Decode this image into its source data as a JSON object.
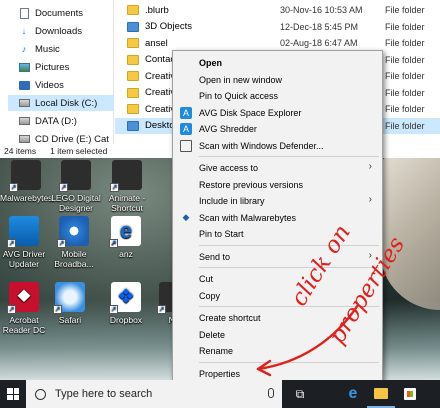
{
  "explorer": {
    "nav": [
      {
        "label": "Documents",
        "icon": "document-icon"
      },
      {
        "label": "Downloads",
        "icon": "download-icon"
      },
      {
        "label": "Music",
        "icon": "music-icon"
      },
      {
        "label": "Pictures",
        "icon": "pictures-icon"
      },
      {
        "label": "Videos",
        "icon": "videos-icon"
      },
      {
        "label": "Local Disk (C:)",
        "icon": "disk-icon",
        "selected": true
      },
      {
        "label": "DATA (D:)",
        "icon": "disk-icon"
      },
      {
        "label": "CD Drive (E:) Cat",
        "icon": "cd-drive-icon"
      }
    ],
    "files": [
      {
        "name": ".blurb",
        "date": "30-Nov-16 10:53 AM",
        "type": "File folder"
      },
      {
        "name": "3D Objects",
        "date": "12-Dec-18 5:45 PM",
        "type": "File folder"
      },
      {
        "name": "ansel",
        "date": "02-Aug-18 6:47 AM",
        "type": "File folder"
      },
      {
        "name": "Contact",
        "date": "",
        "type": "File folder"
      },
      {
        "name": "Creative",
        "date": "",
        "type": "File folder"
      },
      {
        "name": "Creative",
        "date": "",
        "type": "File folder"
      },
      {
        "name": "Creative",
        "date": "",
        "type": "File folder"
      },
      {
        "name": "Desktop",
        "date": "09",
        "type": "File folder",
        "selected": true
      }
    ],
    "status": {
      "items": "24 items",
      "selected": "1 item selected"
    }
  },
  "desktop_icons": [
    {
      "label": "Malwarebytes",
      "kind": "dark"
    },
    {
      "label": "LEGO Digital Designer",
      "kind": "dark"
    },
    {
      "label": "Animate - Shortcut",
      "kind": "dark"
    },
    {
      "label": "AVG Driver Updater",
      "kind": "avg"
    },
    {
      "label": "Mobile Broadba...",
      "kind": "mb"
    },
    {
      "label": "anz",
      "kind": "anz"
    },
    {
      "label": "Acrobat Reader DC",
      "kind": "acrobat"
    },
    {
      "label": "Safari",
      "kind": "safari"
    },
    {
      "label": "Dropbox",
      "kind": "dropbox"
    },
    {
      "label": "Ne",
      "kind": "dark"
    }
  ],
  "context_menu": {
    "groups": [
      [
        {
          "label": "Open",
          "bold": true
        },
        {
          "label": "Open in new window"
        },
        {
          "label": "Pin to Quick access"
        },
        {
          "label": "AVG Disk Space Explorer",
          "icon": "avg-icon"
        },
        {
          "label": "AVG Shredder",
          "icon": "avg-icon"
        },
        {
          "label": "Scan with Windows Defender...",
          "icon": "windows-defender-icon"
        }
      ],
      [
        {
          "label": "Give access to",
          "submenu": true
        },
        {
          "label": "Restore previous versions"
        },
        {
          "label": "Include in library",
          "submenu": true
        },
        {
          "label": "Scan with Malwarebytes",
          "icon": "malwarebytes-icon"
        },
        {
          "label": "Pin to Start"
        }
      ],
      [
        {
          "label": "Send to",
          "submenu": true
        }
      ],
      [
        {
          "label": "Cut"
        },
        {
          "label": "Copy"
        }
      ],
      [
        {
          "label": "Create shortcut"
        },
        {
          "label": "Delete"
        },
        {
          "label": "Rename"
        }
      ],
      [
        {
          "label": "Properties"
        }
      ]
    ]
  },
  "annotation": {
    "line1": "click on",
    "line2": "properties",
    "color": "#e0201b"
  },
  "taskbar": {
    "search_placeholder": "Type here to search",
    "buttons": [
      "task-view-icon",
      "edge-icon",
      "file-explorer-icon",
      "store-icon"
    ]
  }
}
